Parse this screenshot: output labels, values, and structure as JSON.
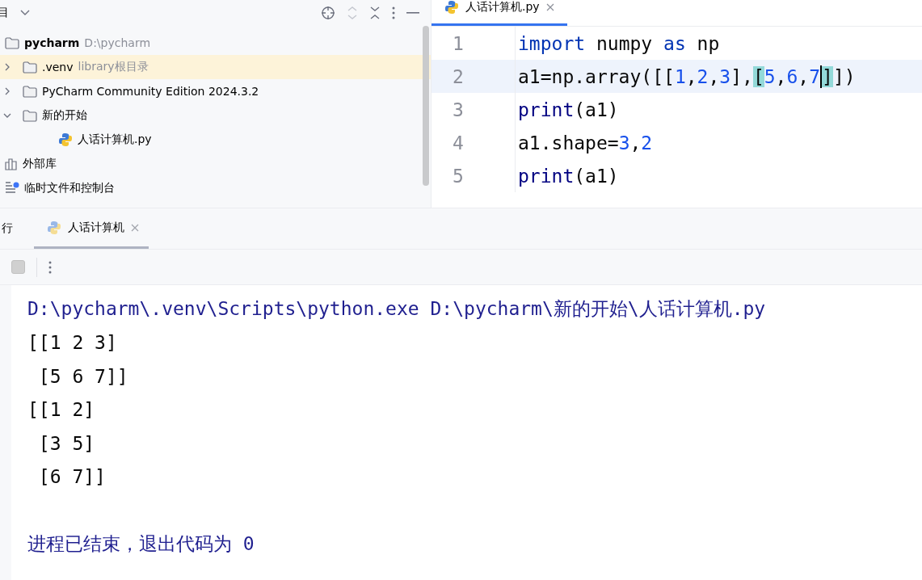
{
  "project_panel": {
    "title": "目",
    "tree": [
      {
        "kind": "folder",
        "label": "pycharm",
        "hint": "D:\\pycharm",
        "highlighted": false,
        "children": [
          {
            "kind": "folder",
            "label": ".venv",
            "hint": "library根目录",
            "expanded": false,
            "highlighted": true
          },
          {
            "kind": "folder",
            "label": "PyCharm Community Edition 2024.3.2",
            "expanded": false,
            "highlighted": false
          },
          {
            "kind": "folder",
            "label": "新的开始",
            "expanded": true,
            "highlighted": false,
            "children": [
              {
                "kind": "python",
                "label": "人话计算机.py",
                "highlighted": false
              }
            ]
          }
        ]
      },
      {
        "kind": "library",
        "label": "外部库",
        "highlighted": false
      },
      {
        "kind": "scratch",
        "label": "临时文件和控制台",
        "highlighted": false
      }
    ]
  },
  "editor": {
    "tabs": [
      {
        "label": "人话计算机.py",
        "selected": true
      }
    ],
    "lines": [
      {
        "number": "1",
        "current": false,
        "tokens": [
          {
            "kind": "keyword",
            "text": "import"
          },
          {
            "kind": "plain",
            "text": " numpy "
          },
          {
            "kind": "keyword",
            "text": "as"
          },
          {
            "kind": "plain",
            "text": " np"
          }
        ]
      },
      {
        "number": "2",
        "current": true,
        "tokens": [
          {
            "kind": "plain",
            "text": "a1=np.array([["
          },
          {
            "kind": "number",
            "text": "1"
          },
          {
            "kind": "plain",
            "text": ","
          },
          {
            "kind": "number",
            "text": "2"
          },
          {
            "kind": "plain",
            "text": ","
          },
          {
            "kind": "number",
            "text": "3"
          },
          {
            "kind": "plain",
            "text": "],"
          },
          {
            "kind": "match",
            "text": "["
          },
          {
            "kind": "number",
            "text": "5"
          },
          {
            "kind": "plain",
            "text": ","
          },
          {
            "kind": "number",
            "text": "6"
          },
          {
            "kind": "plain",
            "text": ","
          },
          {
            "kind": "number",
            "text": "7"
          },
          {
            "kind": "caret"
          },
          {
            "kind": "match",
            "text": "]"
          },
          {
            "kind": "plain",
            "text": "])"
          }
        ]
      },
      {
        "number": "3",
        "current": false,
        "tokens": [
          {
            "kind": "builtin",
            "text": "print"
          },
          {
            "kind": "plain",
            "text": "(a1)"
          }
        ]
      },
      {
        "number": "4",
        "current": false,
        "tokens": [
          {
            "kind": "plain",
            "text": "a1.shape="
          },
          {
            "kind": "number",
            "text": "3"
          },
          {
            "kind": "plain",
            "text": ","
          },
          {
            "kind": "number",
            "text": "2"
          }
        ]
      },
      {
        "number": "5",
        "current": false,
        "tokens": [
          {
            "kind": "builtin",
            "text": "print"
          },
          {
            "kind": "plain",
            "text": "(a1)"
          }
        ]
      }
    ]
  },
  "run_panel": {
    "title": "行",
    "tabs": [
      {
        "label": "人话计算机",
        "selected": true
      }
    ],
    "console": [
      {
        "kind": "command",
        "text": "D:\\pycharm\\.venv\\Scripts\\python.exe D:\\pycharm\\新的开始\\人话计算机.py"
      },
      {
        "kind": "output",
        "text": "[[1 2 3]"
      },
      {
        "kind": "output",
        "text": " [5 6 7]]"
      },
      {
        "kind": "output",
        "text": "[[1 2]"
      },
      {
        "kind": "output",
        "text": " [3 5]"
      },
      {
        "kind": "output",
        "text": " [6 7]]"
      },
      {
        "kind": "blank"
      },
      {
        "kind": "exit",
        "text": "进程已结束，退出代码为 0"
      }
    ]
  }
}
